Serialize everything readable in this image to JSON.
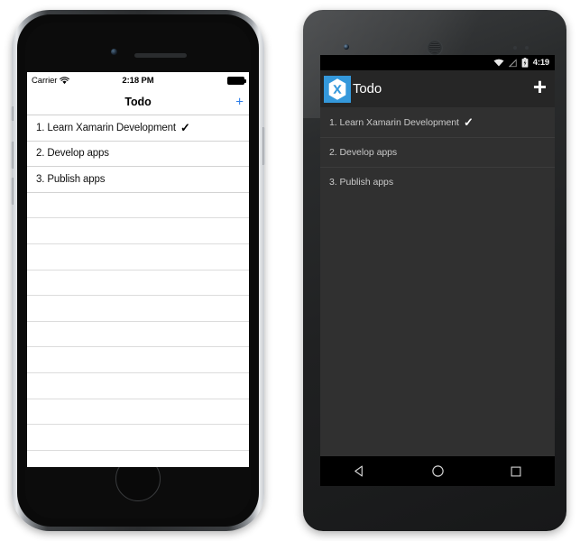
{
  "ios": {
    "status_bar": {
      "carrier": "Carrier",
      "wifi_icon": "wifi-icon",
      "time": "2:18 PM",
      "battery_icon": "battery-full-icon"
    },
    "nav_bar": {
      "title": "Todo",
      "add_label": "+",
      "add_icon": "plus-icon",
      "accent_color": "#2f7fe8"
    },
    "list": {
      "items": [
        {
          "text": "1. Learn Xamarin Development",
          "done": true,
          "check": "✓"
        },
        {
          "text": "2. Develop apps",
          "done": false,
          "check": ""
        },
        {
          "text": "3. Publish apps",
          "done": false,
          "check": ""
        }
      ],
      "empty_row_count": 12
    }
  },
  "android": {
    "status_bar": {
      "wifi_icon": "wifi-icon",
      "no_signal_icon": "no-signal-icon",
      "battery_icon": "battery-charging-icon",
      "time": "4:19"
    },
    "action_bar": {
      "app_icon": "xamarin-logo-icon",
      "title": "Todo",
      "add_label": "+",
      "add_icon": "plus-icon",
      "icon_color": "#3498db"
    },
    "list": {
      "items": [
        {
          "text": "1. Learn Xamarin Development",
          "done": true,
          "check": "✓"
        },
        {
          "text": "2. Develop apps",
          "done": false,
          "check": ""
        },
        {
          "text": "3. Publish apps",
          "done": false,
          "check": ""
        }
      ]
    },
    "nav_bar": {
      "back_icon": "back-triangle-icon",
      "home_icon": "home-circle-icon",
      "recents_icon": "recents-square-icon"
    }
  }
}
